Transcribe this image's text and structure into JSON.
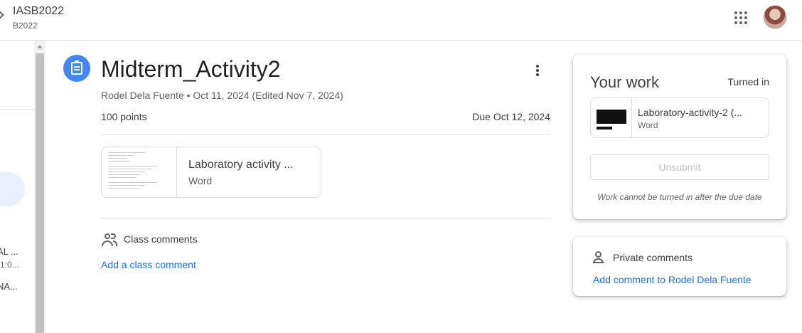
{
  "header": {
    "class_name": "IASB2022",
    "class_section": "B2022",
    "apps_icon": "apps-grid-icon",
    "avatar_icon": "user-avatar"
  },
  "leftnav": {
    "item1": "AL ...",
    "item2": "1:0...",
    "item3": "NA..."
  },
  "assignment": {
    "title": "Midterm_Activity2",
    "meta": "Rodel Dela Fuente • Oct 11, 2024 (Edited Nov 7, 2024)",
    "points": "100 points",
    "due": "Due Oct 12, 2024",
    "attachment": {
      "name": "Laboratory activity ...",
      "type": "Word"
    }
  },
  "class_comments": {
    "label": "Class comments",
    "add_label": "Add a class comment"
  },
  "your_work": {
    "title": "Your work",
    "status": "Turned in",
    "file": {
      "name": "Laboratory-activity-2 (...",
      "type": "Word"
    },
    "unsubmit_label": "Unsubmit",
    "note": "Work cannot be turned in after the due date"
  },
  "private_comments": {
    "label": "Private comments",
    "add_label": "Add comment to Rodel Dela Fuente"
  },
  "colors": {
    "accent": "#1a73e8",
    "icon_blue": "#4285f4"
  }
}
